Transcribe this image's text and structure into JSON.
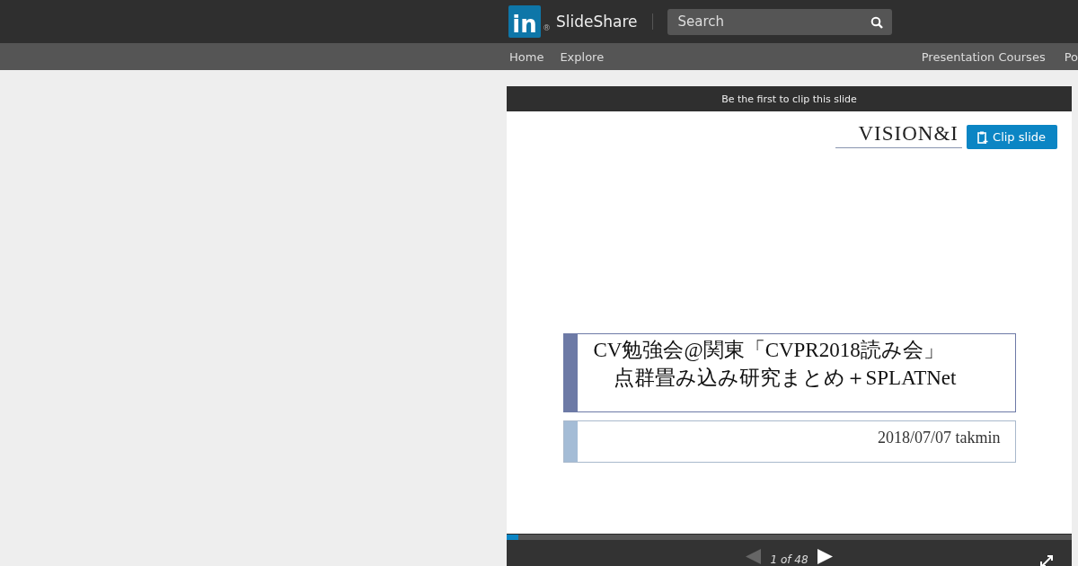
{
  "header": {
    "logo_mark": "in",
    "logo_text": "SlideShare",
    "logo_registered": "®",
    "search": {
      "placeholder": "Search"
    }
  },
  "nav": {
    "left": [
      "Home",
      "Explore"
    ],
    "right": [
      "Presentation Courses",
      "Po"
    ]
  },
  "player": {
    "clip_banner": "Be the first to clip this slide",
    "clip_button": "Clip slide",
    "slide": {
      "logo": "VISION&I",
      "title_lines": [
        "CV勉強会@関東「CVPR2018読み会」",
        "点群畳み込み研究まとめ＋SPLATNet"
      ],
      "subtitle": "2018/07/07 takmin"
    },
    "progress": {
      "level": 0.02
    },
    "prev_disabled": true,
    "counter": "1 of 48"
  }
}
